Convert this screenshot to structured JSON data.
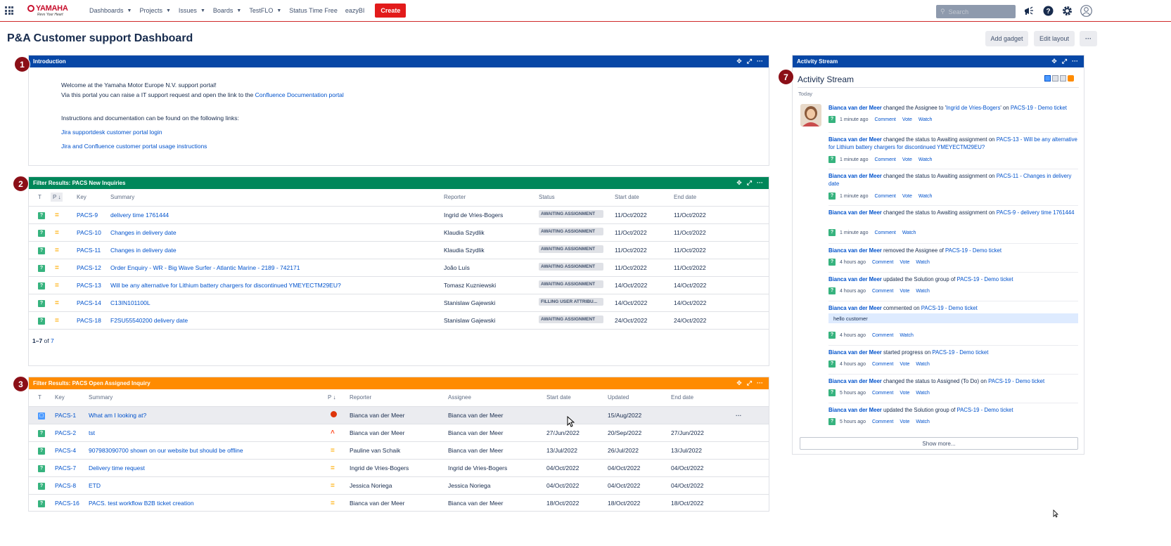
{
  "brand": {
    "name": "YAMAHA",
    "tagline": "Revs Your Heart"
  },
  "nav": {
    "items": [
      "Dashboards",
      "Projects",
      "Issues",
      "Boards",
      "TestFLO",
      "Status Time Free",
      "eazyBI"
    ],
    "create": "Create",
    "search_placeholder": "Search"
  },
  "page": {
    "title": "P&A Customer support Dashboard",
    "add_gadget": "Add gadget",
    "edit_layout": "Edit layout",
    "more": "···"
  },
  "badges": {
    "b1": "1",
    "b2": "2",
    "b3": "3",
    "b7": "7"
  },
  "intro": {
    "title": "Introduction",
    "line1": "Welcome at the Yamaha Motor Europe N.V. support portal!",
    "line2_pre": "Via this portal you can raise a IT support request and open the link to the ",
    "line2_link": "Confluence Documentation portal",
    "line3": "Instructions and documentation can be found on the following links:",
    "link1": "Jira supportdesk customer portal login",
    "link2": "Jira and Confluence customer portal usage instructions"
  },
  "filter1": {
    "title": "Filter Results: PACS New Inquiries",
    "headers": {
      "t": "T",
      "p": "P",
      "key": "Key",
      "summary": "Summary",
      "reporter": "Reporter",
      "status": "Status",
      "start": "Start date",
      "end": "End date"
    },
    "rows": [
      {
        "key": "PACS-9",
        "summary": "delivery time 1761444",
        "reporter": "Ingrid de Vries-Bogers",
        "status": "AWAITING ASSIGNMENT",
        "start": "11/Oct/2022",
        "end": "11/Oct/2022"
      },
      {
        "key": "PACS-10",
        "summary": "Changes in delivery date",
        "reporter": "Klaudia Szydlik",
        "status": "AWAITING ASSIGNMENT",
        "start": "11/Oct/2022",
        "end": "11/Oct/2022"
      },
      {
        "key": "PACS-11",
        "summary": "Changes in delivery date",
        "reporter": "Klaudia Szydlik",
        "status": "AWAITING ASSIGNMENT",
        "start": "11/Oct/2022",
        "end": "11/Oct/2022"
      },
      {
        "key": "PACS-12",
        "summary": "Order Enquiry - WR - Big Wave Surfer - Atlantic Marine - 2189 - 742171",
        "reporter": "João Luís",
        "status": "AWAITING ASSIGNMENT",
        "start": "11/Oct/2022",
        "end": "11/Oct/2022"
      },
      {
        "key": "PACS-13",
        "summary": "Will be any alternative for Lithium battery chargers for discontinued YMEYECTM29EU?",
        "reporter": "Tomasz Kuzniewski",
        "status": "AWAITING ASSIGNMENT",
        "start": "14/Oct/2022",
        "end": "14/Oct/2022"
      },
      {
        "key": "PACS-14",
        "summary": "C13IN101100L",
        "reporter": "Stanislaw Gajewski",
        "status": "FILLING USER ATTRIBU...",
        "start": "14/Oct/2022",
        "end": "14/Oct/2022"
      },
      {
        "key": "PACS-18",
        "summary": "F2SU55540200 delivery date",
        "reporter": "Stanislaw Gajewski",
        "status": "AWAITING ASSIGNMENT",
        "start": "24/Oct/2022",
        "end": "24/Oct/2022"
      }
    ],
    "count_pre": "1–7",
    "count_of": " of ",
    "count_total": "7"
  },
  "filter2": {
    "title": "Filter Results: PACS Open Assigned Inquiry",
    "headers": {
      "t": "T",
      "key": "Key",
      "summary": "Summary",
      "p": "P",
      "reporter": "Reporter",
      "assignee": "Assignee",
      "start": "Start date",
      "updated": "Updated",
      "end": "End date"
    },
    "rows": [
      {
        "type": "blue",
        "key": "PACS-1",
        "summary": "What am I looking at?",
        "priority": "blocker",
        "reporter": "Bianca van der Meer",
        "assignee": "Bianca van der Meer",
        "start": "",
        "updated": "15/Aug/2022",
        "end": ""
      },
      {
        "type": "green",
        "key": "PACS-2",
        "summary": "tst",
        "priority": "high",
        "reporter": "Bianca van der Meer",
        "assignee": "Bianca van der Meer",
        "start": "27/Jun/2022",
        "updated": "20/Sep/2022",
        "end": "27/Jun/2022"
      },
      {
        "type": "green",
        "key": "PACS-4",
        "summary": "907983090700 shown on our website but should be offline",
        "priority": "medium",
        "reporter": "Pauline van Schaik",
        "assignee": "Bianca van der Meer",
        "start": "13/Jul/2022",
        "updated": "26/Jul/2022",
        "end": "13/Jul/2022"
      },
      {
        "type": "green",
        "key": "PACS-7",
        "summary": "Delivery time request",
        "priority": "medium",
        "reporter": "Ingrid de Vries-Bogers",
        "assignee": "Ingrid de Vries-Bogers",
        "start": "04/Oct/2022",
        "updated": "04/Oct/2022",
        "end": "04/Oct/2022"
      },
      {
        "type": "green",
        "key": "PACS-8",
        "summary": "ETD",
        "priority": "medium",
        "reporter": "Jessica Noriega",
        "assignee": "Jessica Noriega",
        "start": "04/Oct/2022",
        "updated": "04/Oct/2022",
        "end": "04/Oct/2022"
      },
      {
        "type": "green",
        "key": "PACS-16",
        "summary": "PACS. test workflow B2B ticket creation",
        "priority": "medium",
        "reporter": "Bianca van der Meer",
        "assignee": "Bianca van der Meer",
        "start": "18/Oct/2022",
        "updated": "18/Oct/2022",
        "end": "18/Oct/2022"
      }
    ],
    "row_more": "···"
  },
  "activity": {
    "bar_title": "Activity Stream",
    "title": "Activity Stream",
    "today": "Today",
    "comment": "Comment",
    "vote": "Vote",
    "watch": "Watch",
    "show_more": "Show more...",
    "entries": [
      {
        "user": "Bianca van der Meer",
        "pre": " changed the Assignee to '",
        "target": "Ingrid de Vries-Bogers",
        "mid": "' on ",
        "issue": "PACS-19 - Demo ticket",
        "time": "1 minute ago",
        "vote": true
      },
      {
        "user": "Bianca van der Meer",
        "pre": " changed the status to Awaiting assignment on ",
        "target": "",
        "mid": "",
        "issue": "PACS-13 - Will be any alternative for Lithium battery chargers for discontinued YMEYECTM29EU?",
        "time": "1 minute ago",
        "vote": true
      },
      {
        "user": "Bianca van der Meer",
        "pre": " changed the status to Awaiting assignment on ",
        "target": "",
        "mid": "",
        "issue": "PACS-11 - Changes in delivery date",
        "time": "1 minute ago",
        "vote": true
      },
      {
        "user": "Bianca van der Meer",
        "pre": " changed the status to Awaiting assignment on ",
        "target": "",
        "mid": "",
        "issue": "PACS-9 - delivery time 1761444",
        "time": "1 minute ago",
        "vote": false
      },
      {
        "user": "Bianca van der Meer",
        "pre": " removed the Assignee of ",
        "target": "",
        "mid": "",
        "issue": "PACS-19 - Demo ticket",
        "time": "4 hours ago",
        "vote": true
      },
      {
        "user": "Bianca van der Meer",
        "pre": " updated the Solution group of ",
        "target": "",
        "mid": "",
        "issue": "PACS-19 - Demo ticket",
        "time": "4 hours ago",
        "vote": true
      },
      {
        "user": "Bianca van der Meer",
        "pre": " commented on ",
        "target": "",
        "mid": "",
        "issue": "PACS-19 - Demo ticket",
        "time": "4 hours ago",
        "vote": false,
        "comment_text": "hello customer"
      },
      {
        "user": "Bianca van der Meer",
        "pre": " started progress on ",
        "target": "",
        "mid": "",
        "issue": "PACS-19 - Demo ticket",
        "time": "4 hours ago",
        "vote": true
      },
      {
        "user": "Bianca van der Meer",
        "pre": " changed the status to Assigned (To Do) on ",
        "target": "",
        "mid": "",
        "issue": "PACS-19 - Demo ticket",
        "time": "5 hours ago",
        "vote": true
      },
      {
        "user": "Bianca van der Meer",
        "pre": " updated the Solution group of ",
        "target": "",
        "mid": "",
        "issue": "PACS-19 - Demo ticket",
        "time": "5 hours ago",
        "vote": true
      }
    ]
  },
  "colors": {
    "intro_bar": "#0747a6",
    "filter1_bar": "#00875a",
    "filter2_bar": "#ff8b00",
    "activity_bar": "#0747a6",
    "badge": "#8b0f17",
    "create": "#e21b1b"
  }
}
